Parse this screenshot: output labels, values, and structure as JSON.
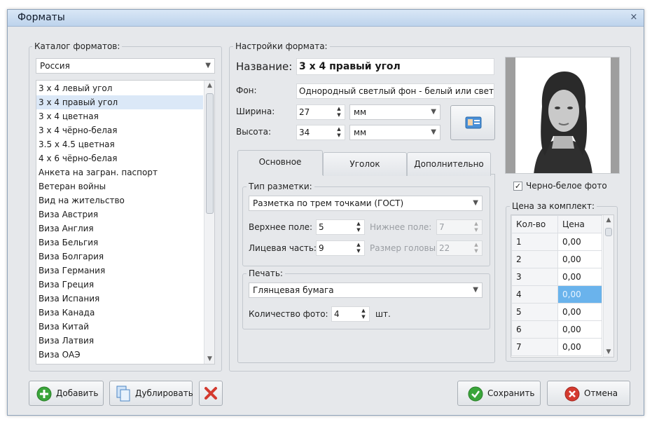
{
  "window": {
    "title": "Форматы",
    "close_glyph": "×"
  },
  "catalog": {
    "group_label": "Каталог форматов:",
    "country_selected": "Россия",
    "items": [
      "3 х 4 левый угол",
      "3 х 4 правый угол",
      "3 х 4 цветная",
      "3 х 4 чёрно-белая",
      "3.5 х 4.5 цветная",
      "4 х 6 чёрно-белая",
      "Анкета на загран. паспорт",
      "Ветеран войны",
      "Вид на жительство",
      "Виза Австрия",
      "Виза Англия",
      "Виза Бельгия",
      "Виза Болгария",
      "Виза Германия",
      "Виза Греция",
      "Виза Испания",
      "Виза Канада",
      "Виза Китай",
      "Виза Латвия",
      "Виза ОАЭ"
    ],
    "selected_index": 1
  },
  "settings": {
    "group_label": "Настройки формата:",
    "name_label": "Название:",
    "name_value": "3 х 4 правый угол",
    "bg_label": "Фон:",
    "bg_value": "Однородный светлый фон - белый или светло-",
    "width_label": "Ширина:",
    "width_value": "27",
    "width_unit": "мм",
    "height_label": "Высота:",
    "height_value": "34",
    "height_unit": "мм"
  },
  "tabs": [
    {
      "label": "Основное",
      "active": true
    },
    {
      "label": "Уголок",
      "active": false
    },
    {
      "label": "Дополнительно",
      "active": false
    }
  ],
  "markup": {
    "group_label": "Тип разметки:",
    "type_selected": "Разметка по трем точками (ГОСТ)",
    "top_margin_label": "Верхнее поле:",
    "top_margin_value": "5",
    "bottom_margin_label": "Нижнее поле:",
    "bottom_margin_value": "7",
    "face_label": "Лицевая часть:",
    "face_value": "9",
    "head_size_label": "Размер головы:",
    "head_size_value": "22"
  },
  "print": {
    "group_label": "Печать:",
    "paper_selected": "Глянцевая бумага",
    "count_label": "Количество фото:",
    "count_value": "4",
    "count_unit": "шт."
  },
  "photo": {
    "bw_checkbox_label": "Черно-белое фото",
    "bw_checked": true,
    "check_glyph": "✓"
  },
  "price": {
    "group_label": "Цена за комплект:",
    "col_qty": "Кол-во",
    "col_price": "Цена",
    "rows": [
      {
        "qty": "1",
        "price": "0,00"
      },
      {
        "qty": "2",
        "price": "0,00"
      },
      {
        "qty": "3",
        "price": "0,00"
      },
      {
        "qty": "4",
        "price": "0,00"
      },
      {
        "qty": "5",
        "price": "0,00"
      },
      {
        "qty": "6",
        "price": "0,00"
      },
      {
        "qty": "7",
        "price": "0,00"
      }
    ],
    "selected_row": 3
  },
  "buttons": {
    "add": "Добавить",
    "duplicate": "Дублировать",
    "save": "Сохранить",
    "cancel": "Отмена"
  },
  "icons": {
    "add": "plus-circle-icon",
    "duplicate": "copy-documents-icon",
    "delete": "red-x-icon",
    "save": "green-check-icon",
    "cancel": "red-x-circle-icon",
    "id_card": "id-card-icon"
  },
  "colors": {
    "selection": "#dbe8f7",
    "table_selection": "#6ab3ec",
    "add_green": "#3aa53a",
    "cancel_red": "#d43a2f"
  }
}
